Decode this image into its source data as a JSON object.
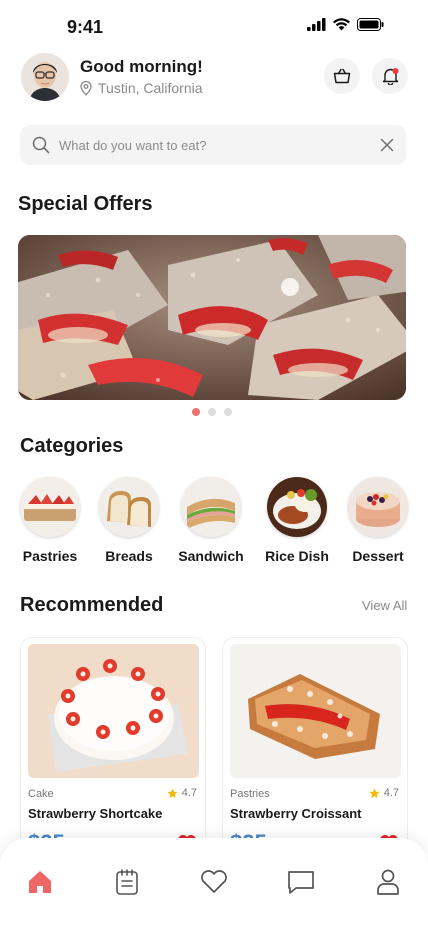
{
  "status_bar": {
    "time": "9:41",
    "icons": [
      "signal-icon",
      "wifi-icon",
      "battery-icon"
    ]
  },
  "header": {
    "greeting": "Good morning!",
    "location": "Tustin, California",
    "icons": [
      "location-pin-icon",
      "shopping-bag-icon",
      "bell-icon"
    ]
  },
  "search": {
    "placeholder": "What do you want to eat?",
    "value": "",
    "icons": [
      "search-icon",
      "clear-icon"
    ]
  },
  "special_offers": {
    "title": "Special Offers",
    "carousel": {
      "page_count": 3,
      "active_index": 0
    }
  },
  "categories": {
    "title": "Categories",
    "items": [
      {
        "label": "Pastries"
      },
      {
        "label": "Breads"
      },
      {
        "label": "Sandwich"
      },
      {
        "label": "Rice Dish"
      },
      {
        "label": "Dessert"
      }
    ]
  },
  "recommended": {
    "title": "Recommended",
    "view_all": "View All",
    "items": [
      {
        "category": "Cake",
        "rating": "4.7",
        "name": "Strawberry Shortcake",
        "price": "$25"
      },
      {
        "category": "Pastries",
        "rating": "4.7",
        "name": "Strawberry Croissant",
        "price": "$25"
      }
    ]
  },
  "bottom_nav": {
    "items": [
      {
        "icon": "home-icon",
        "active": true
      },
      {
        "icon": "orders-icon",
        "active": false
      },
      {
        "icon": "favorites-icon",
        "active": false
      },
      {
        "icon": "chat-icon",
        "active": false
      },
      {
        "icon": "profile-icon",
        "active": false
      }
    ]
  },
  "colors": {
    "accent": "#ee6666",
    "price": "#4a88c8",
    "star": "#f5b800",
    "heart": "#e02424"
  }
}
